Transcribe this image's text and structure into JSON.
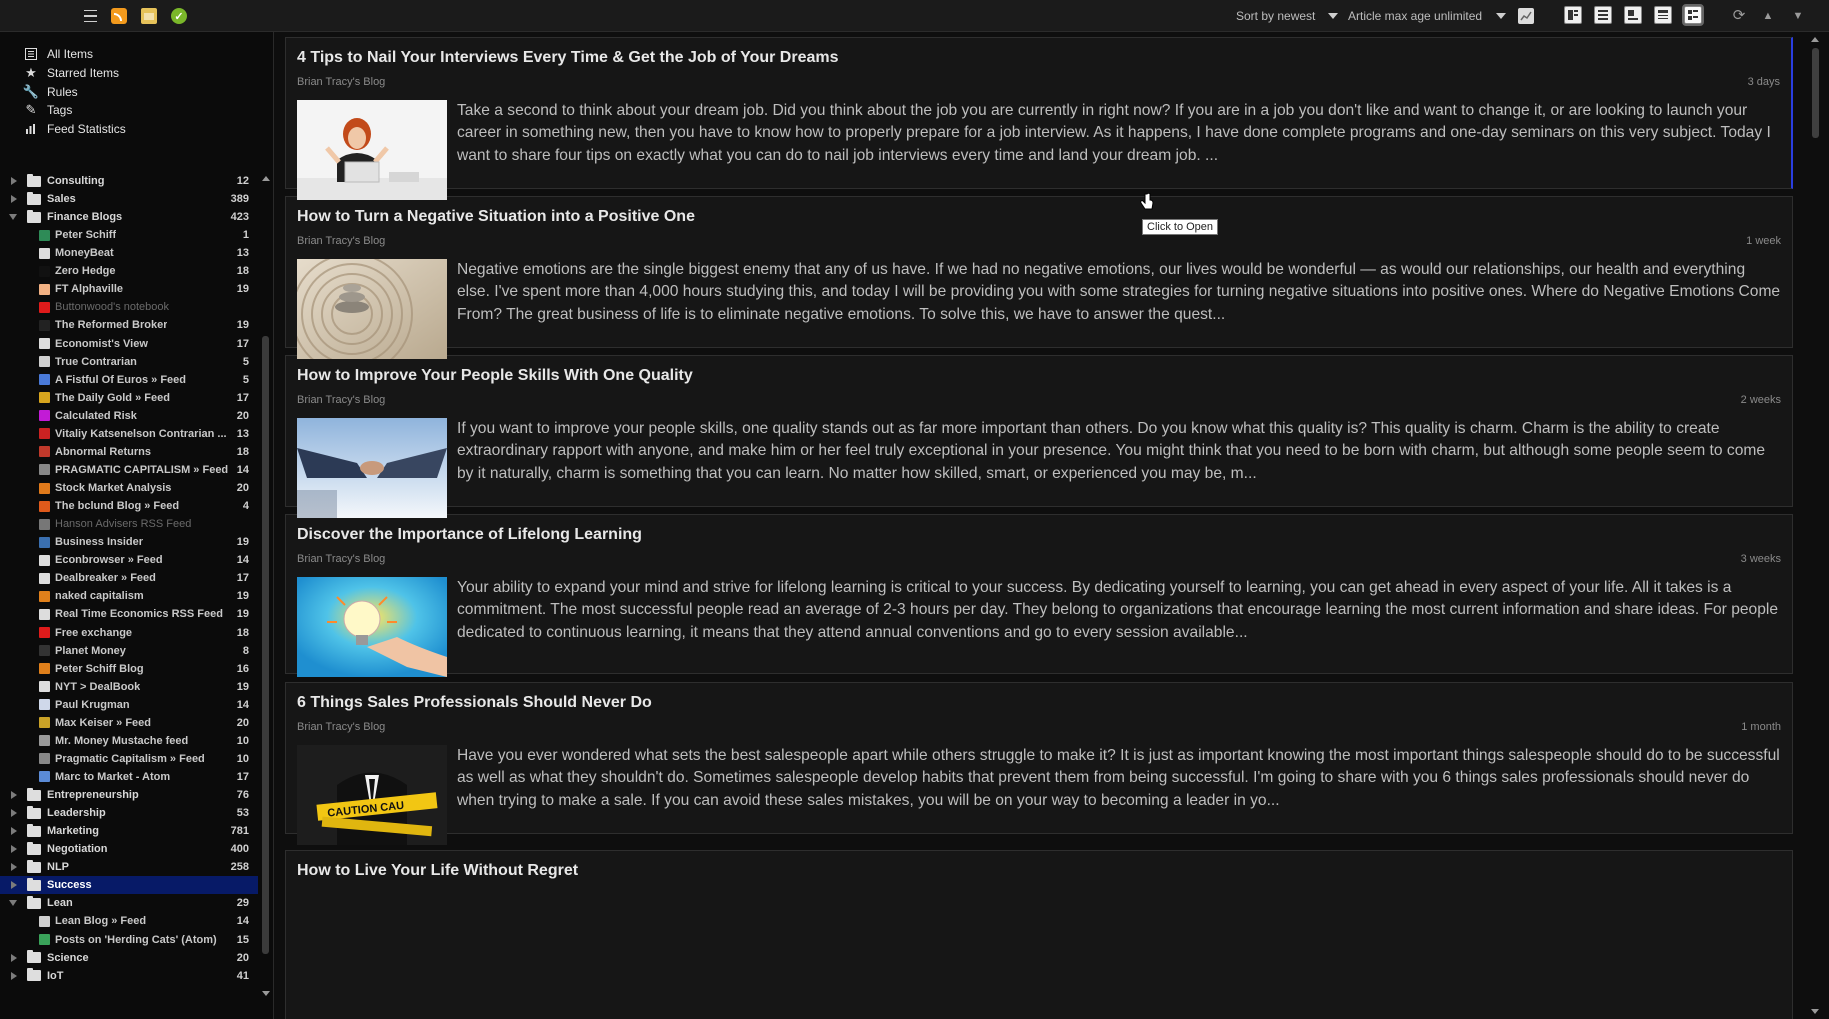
{
  "toolbar": {
    "sort_label": "Sort by newest",
    "age_label": "Article max age unlimited"
  },
  "nav": [
    {
      "label": "All Items",
      "icon": "list-icon"
    },
    {
      "label": "Starred Items",
      "icon": "star-icon"
    },
    {
      "label": "Rules",
      "icon": "wrench-icon"
    },
    {
      "label": "Tags",
      "icon": "tag-icon"
    },
    {
      "label": "Feed Statistics",
      "icon": "bar-chart-icon"
    }
  ],
  "folders_top": [
    {
      "label": "Consulting",
      "count": "12"
    },
    {
      "label": "Sales",
      "count": "389"
    },
    {
      "label": "Finance Blogs",
      "count": "423"
    }
  ],
  "finance_feeds": [
    {
      "label": "Peter Schiff",
      "count": "1",
      "color": "#2e8b57"
    },
    {
      "label": "MoneyBeat",
      "count": "13",
      "color": "#dddddd"
    },
    {
      "label": "Zero Hedge",
      "count": "18",
      "color": "#111111"
    },
    {
      "label": "FT Alphaville",
      "count": "19",
      "color": "#f2b183"
    },
    {
      "label": "Buttonwood's notebook",
      "count": "",
      "color": "#e01b1b",
      "dim": true
    },
    {
      "label": "The Reformed Broker",
      "count": "19",
      "color": "#222222"
    },
    {
      "label": "Economist's View",
      "count": "17",
      "color": "#dddddd"
    },
    {
      "label": "True Contrarian",
      "count": "5",
      "color": "#cfcfcf"
    },
    {
      "label": "A Fistful Of Euros » Feed",
      "count": "5",
      "color": "#4a7ad8"
    },
    {
      "label": "The Daily Gold » Feed",
      "count": "17",
      "color": "#d7a51e"
    },
    {
      "label": "Calculated Risk",
      "count": "20",
      "color": "#c21bd6"
    },
    {
      "label": "Vitaliy Katsenelson Contrarian ...",
      "count": "13",
      "color": "#cc2222"
    },
    {
      "label": "Abnormal Returns",
      "count": "18",
      "color": "#c0392b"
    },
    {
      "label": "PRAGMATIC CAPITALISM » Feed",
      "count": "14",
      "color": "#888888"
    },
    {
      "label": "Stock Market Analysis",
      "count": "20",
      "color": "#e07a1b"
    },
    {
      "label": "The bclund Blog » Feed",
      "count": "4",
      "color": "#e05a1b"
    },
    {
      "label": "Hanson Advisers RSS Feed",
      "count": "",
      "color": "#777777",
      "dim": true
    },
    {
      "label": "Business Insider",
      "count": "19",
      "color": "#3a6fb0"
    },
    {
      "label": "Econbrowser » Feed",
      "count": "14",
      "color": "#dddddd"
    },
    {
      "label": "Dealbreaker » Feed",
      "count": "17",
      "color": "#dddddd"
    },
    {
      "label": "naked capitalism",
      "count": "19",
      "color": "#e0801b"
    },
    {
      "label": "Real Time Economics RSS Feed",
      "count": "19",
      "color": "#dddddd"
    },
    {
      "label": "Free exchange",
      "count": "18",
      "color": "#e01b1b"
    },
    {
      "label": "Planet Money",
      "count": "8",
      "color": "#333333"
    },
    {
      "label": "Peter Schiff Blog",
      "count": "16",
      "color": "#e0801b"
    },
    {
      "label": "NYT > DealBook",
      "count": "19",
      "color": "#dddddd"
    },
    {
      "label": "Paul Krugman",
      "count": "14",
      "color": "#cfd8ea"
    },
    {
      "label": "Max Keiser » Feed",
      "count": "20",
      "color": "#c9a227"
    },
    {
      "label": "Mr. Money Mustache feed",
      "count": "10",
      "color": "#999999"
    },
    {
      "label": "Pragmatic Capitalism » Feed",
      "count": "10",
      "color": "#888888"
    },
    {
      "label": "Marc to Market - Atom",
      "count": "17",
      "color": "#5b8bd6"
    }
  ],
  "folders_mid": [
    {
      "label": "Entrepreneurship",
      "count": "76"
    },
    {
      "label": "Leadership",
      "count": "53"
    },
    {
      "label": "Marketing",
      "count": "781"
    },
    {
      "label": "Negotiation",
      "count": "400"
    },
    {
      "label": "NLP",
      "count": "258"
    },
    {
      "label": "Success",
      "count": ""
    },
    {
      "label": "Lean",
      "count": "29"
    }
  ],
  "lean_feeds": [
    {
      "label": "Lean Blog » Feed",
      "count": "14",
      "color": "#cfcfcf"
    },
    {
      "label": "Posts on 'Herding Cats' (Atom)",
      "count": "15",
      "color": "#3aa35a"
    }
  ],
  "folders_bottom": [
    {
      "label": "Science",
      "count": "20"
    },
    {
      "label": "IoT",
      "count": "41"
    }
  ],
  "articles": [
    {
      "title": "4 Tips to Nail Your Interviews Every Time & Get the Job of Your Dreams",
      "source": "Brian Tracy's Blog",
      "age": "3 days",
      "text": "Take a second to think about your dream job. Did you think about the job you are currently in right now? If you are in a job you don't like and want to change it, or are looking to launch your career in something new, then you have to know how to properly prepare for a job interview. As it happens, I have done complete programs and one-day seminars on this very subject. Today I want to share four tips on exactly what you can do to nail job interviews every time and land your dream job. ..."
    },
    {
      "title": "How to Turn a Negative Situation into a Positive One",
      "source": "Brian Tracy's Blog",
      "age": "1 week",
      "text": "Negative emotions are the single biggest enemy that any of us have. If we had no negative emotions, our lives would be wonderful — as would our relationships, our health and everything else. I've spent more than 4,000 hours studying this, and today I will be providing you with some strategies for turning negative situations into positive ones. Where do Negative Emotions Come From? The great business of life is to eliminate negative emotions. To solve this, we have to answer the quest..."
    },
    {
      "title": "How to Improve Your People Skills With One Quality",
      "source": "Brian Tracy's Blog",
      "age": "2 weeks",
      "text": "If you want to improve your people skills, one quality stands out as far more important than others. Do you know what this quality is? This quality is charm. Charm is the ability to create extraordinary rapport with anyone, and make him or her feel truly exceptional in your presence. You might think that you need to be born with charm, but although some people seem to come by it naturally, charm is something that you can learn. No matter how skilled, smart, or experienced you may be, m..."
    },
    {
      "title": "Discover the Importance of Lifelong Learning",
      "source": "Brian Tracy's Blog",
      "age": "3 weeks",
      "text": "Your ability to expand your mind and strive for lifelong learning is critical to your success. By dedicating yourself to learning, you can get ahead in every aspect of your life. All it takes is a commitment. The most successful people read an average of 2-3 hours per day. They belong to organizations that encourage learning the most current information and share ideas. For people dedicated to continuous learning, it means that they attend annual conventions and go to every session available..."
    },
    {
      "title": "6 Things Sales Professionals Should Never Do",
      "source": "Brian Tracy's Blog",
      "age": "1 month",
      "text": "Have you ever wondered what sets the best salespeople apart while others struggle to make it? It is just as important knowing the most important things salespeople should do to be successful as well as what they shouldn't do. Sometimes salespeople develop habits that prevent them from being successful. I'm going to share with you 6 things sales professionals should never do when trying to make a sale. If you can avoid these sales mistakes, you will be on your way to becoming a leader in yo..."
    },
    {
      "title": "How to Live Your Life Without Regret",
      "source": "",
      "age": "",
      "text": ""
    }
  ],
  "tooltip": "Click to Open"
}
